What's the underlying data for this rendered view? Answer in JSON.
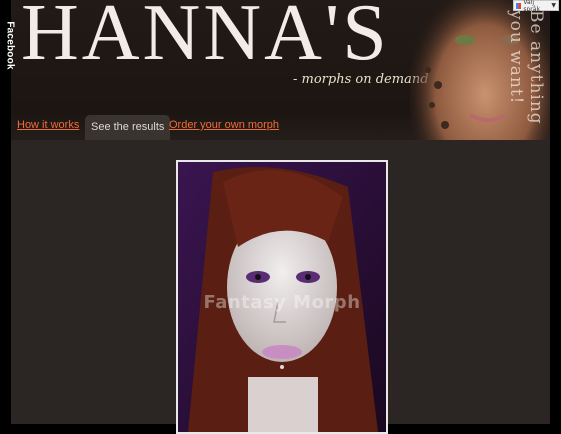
{
  "sidebar": {
    "facebook_label": "Facebook"
  },
  "header": {
    "brand": "HANNA'S",
    "tagline": "- morphs on demand",
    "slogan": "Be anything you want!"
  },
  "nav": {
    "tabs": [
      {
        "label": "How it works",
        "active": false
      },
      {
        "label": "See the results",
        "active": true
      },
      {
        "label": "Order your own morph",
        "active": false
      }
    ]
  },
  "main": {
    "photo_watermark": "Fantasy Morph"
  },
  "widget": {
    "translate_label": "Välj språk"
  },
  "colors": {
    "tab_link": "#f06d3a",
    "page_bg": "#2b2623",
    "header_bg": "#1c1512",
    "photo_purple": "#2a0f3a"
  }
}
